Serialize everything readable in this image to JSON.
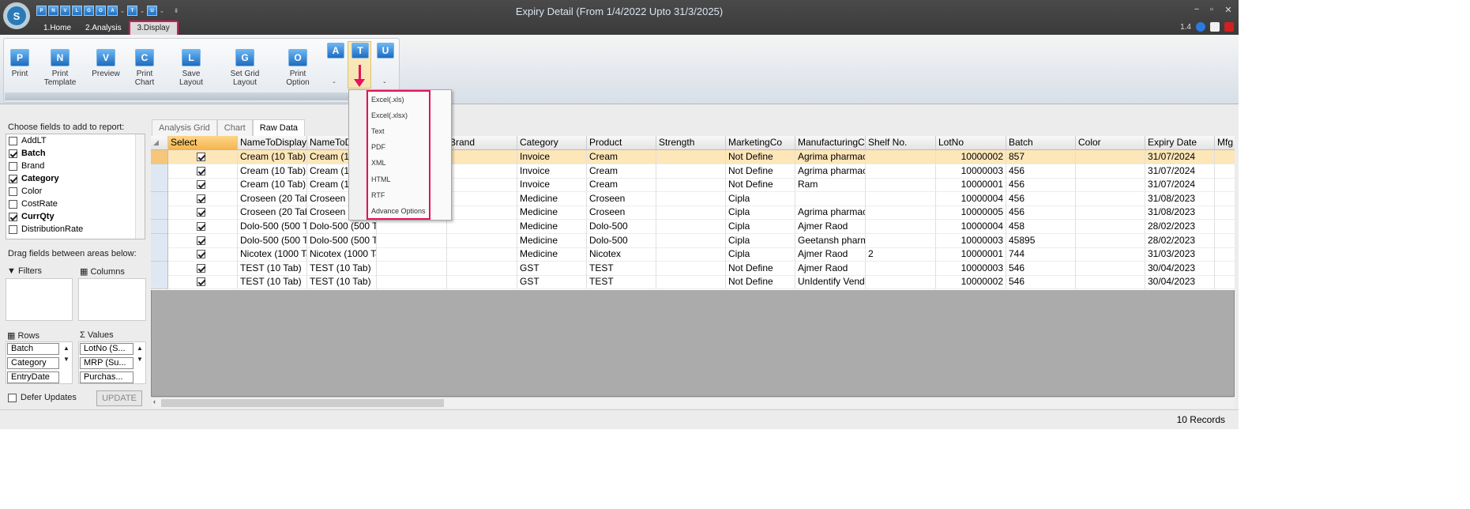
{
  "window": {
    "title": "Expiry Detail (From 1/4/2022 Upto 31/3/2025)",
    "version": "1.4"
  },
  "quick_access": [
    "P",
    "N",
    "V",
    "L",
    "G",
    "O",
    "A",
    "T",
    "U"
  ],
  "menu_tabs": [
    "1.Home",
    "2.Analysis",
    "3.Display"
  ],
  "ribbon": {
    "buttons": [
      "Print",
      "Print Template",
      "Preview",
      "Print Chart",
      "Save Layout",
      "Set Grid Layout",
      "Print Option"
    ],
    "icon_letters": [
      "P",
      "N",
      "V",
      "C",
      "L",
      "G",
      "O",
      "A",
      "T",
      "U"
    ]
  },
  "export_menu": [
    "Excel(.xls)",
    "Excel(.xlsx)",
    "Text",
    "PDF",
    "XML",
    "HTML",
    "RTF",
    "Advance Options"
  ],
  "left_panel": {
    "choose_label": "Choose fields to add to report:",
    "fields": [
      {
        "name": "AddLT",
        "checked": false,
        "bold": false
      },
      {
        "name": "Batch",
        "checked": true,
        "bold": true
      },
      {
        "name": "Brand",
        "checked": false,
        "bold": false
      },
      {
        "name": "Category",
        "checked": true,
        "bold": true
      },
      {
        "name": "Color",
        "checked": false,
        "bold": false
      },
      {
        "name": "CostRate",
        "checked": false,
        "bold": false
      },
      {
        "name": "CurrQty",
        "checked": true,
        "bold": true
      },
      {
        "name": "DistributionRate",
        "checked": false,
        "bold": false
      }
    ],
    "drag_label": "Drag fields between areas below:",
    "filters_label": "Filters",
    "columns_label": "Columns",
    "rows_label": "Rows",
    "values_label": "Values",
    "rows": [
      "Batch",
      "Category",
      "EntryDate"
    ],
    "values": [
      "LotNo (S...",
      "MRP (Su...",
      "Purchas..."
    ],
    "defer_label": "Defer Updates",
    "update_label": "UPDATE"
  },
  "view_tabs": [
    "Analysis Grid",
    "Chart",
    "Raw Data"
  ],
  "grid": {
    "columns": [
      "Select",
      "NameToDisplay",
      "NameToD",
      "",
      "Brand",
      "Category",
      "Product",
      "Strength",
      "MarketingCo",
      "ManufacturingCo",
      "Shelf No.",
      "LotNo",
      "Batch",
      "Color",
      "Expiry Date",
      "Mfg"
    ],
    "rows": [
      [
        "Cream (10 Tab)",
        "Cream (10",
        "",
        "",
        "Invoice",
        "Cream",
        "",
        "Not Define",
        "Agrima pharmac",
        "",
        "10000002",
        "857",
        "",
        "31/07/2024"
      ],
      [
        "Cream (10 Tab)",
        "Cream (10",
        "",
        "",
        "Invoice",
        "Cream",
        "",
        "Not Define",
        "Agrima pharmac",
        "",
        "10000003",
        "456",
        "",
        "31/07/2024"
      ],
      [
        "Cream (10 Tab)",
        "Cream (10",
        "",
        "",
        "Invoice",
        "Cream",
        "",
        "Not Define",
        "Ram",
        "",
        "10000001",
        "456",
        "",
        "31/07/2024"
      ],
      [
        "Croseen (20 Tab",
        "Croseen (",
        "",
        "",
        "Medicine",
        "Croseen",
        "",
        "Cipla",
        "",
        "",
        "10000004",
        "456",
        "",
        "31/08/2023"
      ],
      [
        "Croseen (20 Tab",
        "Croseen (",
        "",
        "",
        "Medicine",
        "Croseen",
        "",
        "Cipla",
        "Agrima pharmac",
        "",
        "10000005",
        "456",
        "",
        "31/08/2023"
      ],
      [
        "Dolo-500 (500 Ta",
        "Dolo-500 (500 Ta",
        "",
        "",
        "Medicine",
        "Dolo-500",
        "",
        "Cipla",
        "Ajmer Raod",
        "",
        "10000004",
        "458",
        "",
        "28/02/2023"
      ],
      [
        "Dolo-500 (500 Ta",
        "Dolo-500 (500 Ta",
        "",
        "",
        "Medicine",
        "Dolo-500",
        "",
        "Cipla",
        "Geetansh pharm",
        "",
        "10000003",
        "45895",
        "",
        "28/02/2023"
      ],
      [
        "Nicotex (1000 Ta",
        "Nicotex (1000 Ta",
        "",
        "",
        "Medicine",
        "Nicotex",
        "",
        "Cipla",
        "Ajmer Raod",
        "2",
        "10000001",
        "744",
        "",
        "31/03/2023"
      ],
      [
        "TEST (10 Tab)",
        "TEST (10 Tab)",
        "",
        "",
        "GST",
        "TEST",
        "",
        "Not Define",
        "Ajmer Raod",
        "",
        "10000003",
        "546",
        "",
        "30/04/2023"
      ],
      [
        "TEST (10 Tab)",
        "TEST (10 Tab)",
        "",
        "",
        "GST",
        "TEST",
        "",
        "Not Define",
        "UnIdentify Vendo",
        "",
        "10000002",
        "546",
        "",
        "30/04/2023"
      ]
    ]
  },
  "status": {
    "records": "10 Records"
  },
  "colors": {
    "highlight": "#e8115a",
    "title_bg": "#3f3f3f",
    "select_header": "#f4b650"
  }
}
